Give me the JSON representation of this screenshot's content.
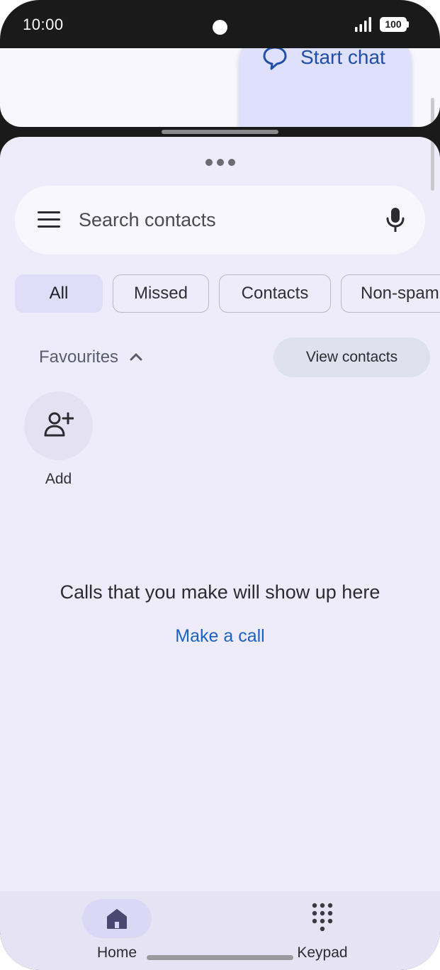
{
  "status_bar": {
    "time": "10:00",
    "battery": "100",
    "signal_icon": "signal-icon",
    "battery_icon": "battery-icon"
  },
  "top_app": {
    "start_chat_label": "Start chat",
    "start_chat_icon": "chat-bubble-icon"
  },
  "search": {
    "placeholder": "Search contacts",
    "menu_icon": "menu-icon",
    "mic_icon": "mic-icon"
  },
  "filters": [
    {
      "label": "All",
      "active": true
    },
    {
      "label": "Missed",
      "active": false
    },
    {
      "label": "Contacts",
      "active": false
    },
    {
      "label": "Non-spam",
      "active": false
    }
  ],
  "favourites": {
    "label": "Favourites",
    "view_contacts_label": "View contacts",
    "add_label": "Add",
    "add_icon": "person-add-icon"
  },
  "empty_state": {
    "message": "Calls that you make will show up here",
    "action_label": "Make a call"
  },
  "bottom_nav": {
    "home_label": "Home",
    "keypad_label": "Keypad",
    "home_icon": "home-icon",
    "keypad_icon": "dialpad-icon"
  },
  "colors": {
    "accent": "#1a62c4",
    "background": "#eeecfa",
    "active_chip": "#dfddf8"
  }
}
